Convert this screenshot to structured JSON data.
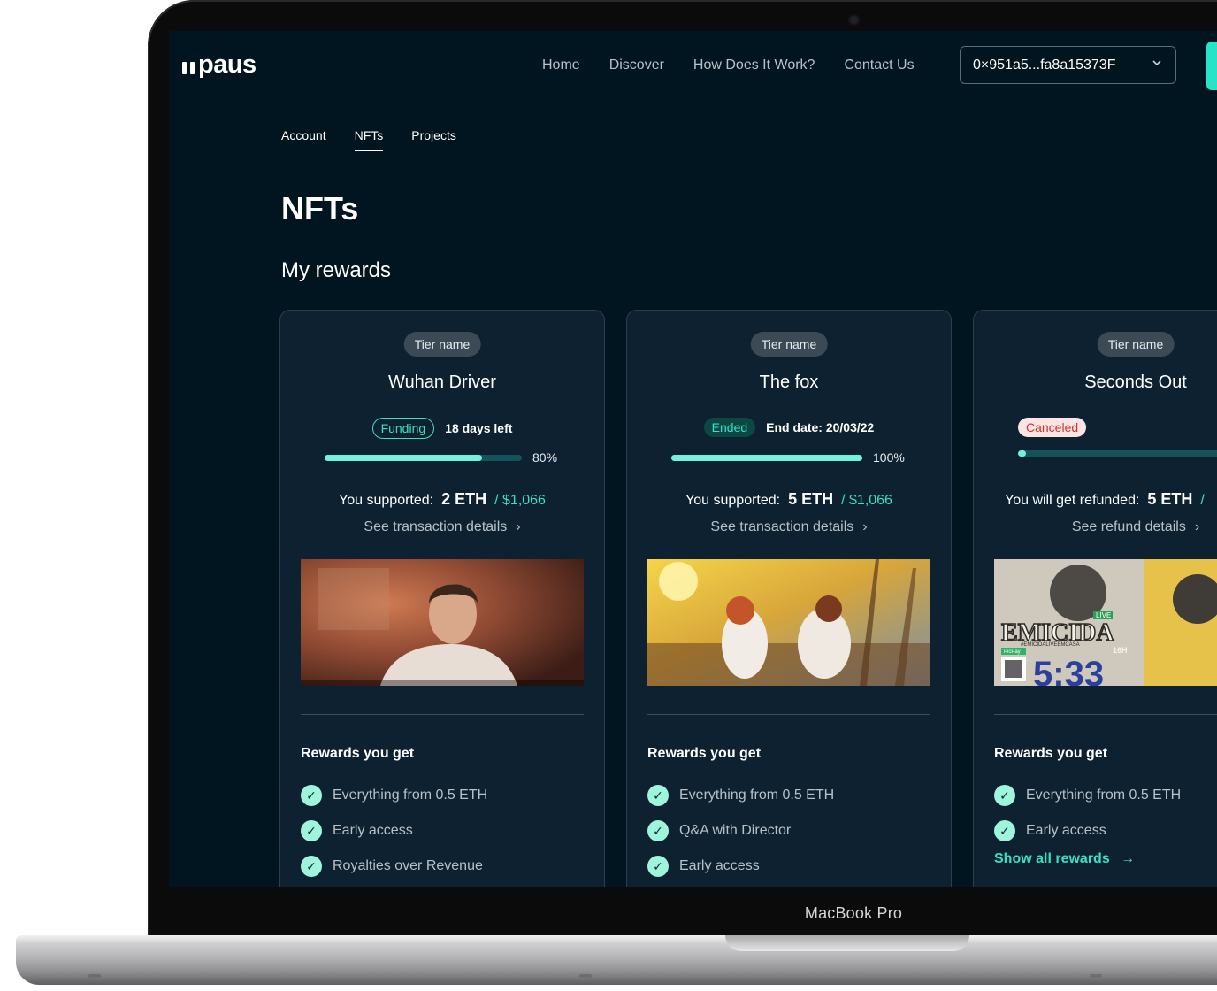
{
  "device": {
    "label": "MacBook Pro"
  },
  "header": {
    "logo_text": "paus",
    "nav": [
      "Home",
      "Discover",
      "How Does It Work?",
      "Contact Us"
    ],
    "wallet_address": "0×951a5...fa8a15373F"
  },
  "subnav": {
    "tabs": [
      "Account",
      "NFTs",
      "Projects"
    ],
    "active_tab": "NFTs"
  },
  "page": {
    "title": "NFTs",
    "section_title": "My rewards"
  },
  "cards": [
    {
      "tier": "Tier name",
      "title": "Wuhan Driver",
      "badge": "Funding",
      "status_text": "18 days left",
      "progress_percent": 80,
      "progress_label": "80%",
      "support_label": "You supported:",
      "amount": "2 ETH",
      "usd": "/ $1,066",
      "details_label": "See transaction details",
      "rewards_heading": "Rewards you get",
      "rewards": [
        "Everything from 0.5 ETH",
        "Early access",
        "Royalties over Revenue"
      ]
    },
    {
      "tier": "Tier name",
      "title": "The fox",
      "badge": "Ended",
      "status_text": "End date: 20/03/22",
      "progress_percent": 100,
      "progress_label": "100%",
      "support_label": "You supported:",
      "amount": "5 ETH",
      "usd": "/ $1,066",
      "details_label": "See transaction details",
      "rewards_heading": "Rewards you get",
      "rewards": [
        "Everything from 0.5 ETH",
        "Q&A with Director",
        "Early access"
      ]
    },
    {
      "tier": "Tier name",
      "title": "Seconds Out",
      "badge": "Canceled",
      "status_text": "",
      "progress_percent": 3,
      "progress_label": "",
      "support_label": "You will get refunded:",
      "amount": "5 ETH",
      "usd": "/",
      "details_label": "See refund details",
      "rewards_heading": "Rewards you get",
      "rewards": [
        "Everything from 0.5 ETH",
        "Early access"
      ],
      "show_all_label": "Show all rewards",
      "media_text": {
        "headline": "EMICIDA",
        "live": "LIVE",
        "hashtag": "#EMICIDALIVEEMCASA",
        "countdown": "5:33",
        "hour": "16H",
        "pay": "PicPay"
      }
    }
  ],
  "colors": {
    "screen_bg": "#011520",
    "card_bg": "#0d2130",
    "accent": "#35e0c6",
    "progress_fill": "#73f0de",
    "canceled_bg": "#fde4e4",
    "canceled_text": "#c8362f"
  },
  "icons": [
    "chevron-down-icon",
    "chevron-right-icon",
    "check-circle-icon",
    "arrow-right-icon"
  ]
}
